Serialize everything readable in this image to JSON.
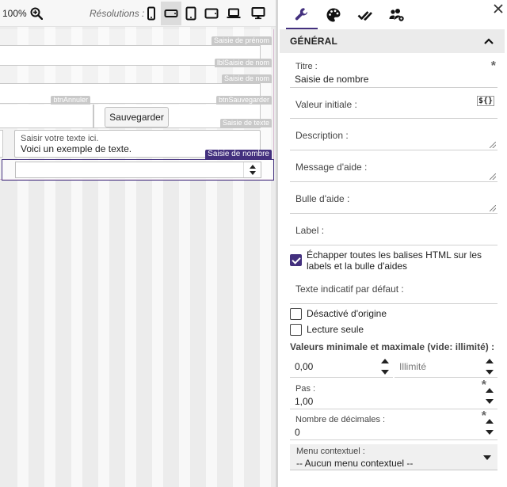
{
  "toolbar": {
    "zoom_level": "100%",
    "resolutions_label": "Résolutions :",
    "resolutions": [
      {
        "icon": "smartphone-portrait-icon",
        "active": false
      },
      {
        "icon": "smartphone-landscape-icon",
        "active": true
      },
      {
        "icon": "tablet-portrait-icon",
        "active": false
      },
      {
        "icon": "tablet-landscape-icon",
        "active": false
      },
      {
        "icon": "laptop-icon",
        "active": false
      },
      {
        "icon": "desktop-icon",
        "active": false
      }
    ]
  },
  "canvas": {
    "tags": {
      "prenom": "Saisie de prénom",
      "lbl_nom": "lblSaisie de nom",
      "nom": "Saisie de nom",
      "btn_annuler": "btnAnnuler",
      "btn_sauvegarder": "btnSauvegarder",
      "texte": "Saisie de texte",
      "nombre": "Saisie de nombre"
    },
    "save_button_label": "Sauvegarder",
    "textarea_placeholder": "Saisir votre texte ici.",
    "textarea_value": "Voici un exemple de texte."
  },
  "properties": {
    "tabs": [
      {
        "icon": "wrench-icon",
        "active": true
      },
      {
        "icon": "palette-icon",
        "active": false
      },
      {
        "icon": "checkmarks-icon",
        "active": false
      },
      {
        "icon": "users-gear-icon",
        "active": false
      }
    ],
    "section_title": "GÉNÉRAL",
    "fields": {
      "titre_label": "Titre :",
      "titre_value": "Saisie de nombre",
      "valeur_initiale_label": "Valeur initiale :",
      "expression_icon_text": "${}",
      "description_label": "Description :",
      "message_aide_label": "Message d'aide :",
      "bulle_aide_label": "Bulle d'aide :",
      "label_label": "Label :",
      "echapper_label": "Échapper toutes les balises HTML sur les labels et la bulle d'aides",
      "echapper_checked": true,
      "texte_indicatif_label": "Texte indicatif par défaut :",
      "desactive_label": "Désactivé d'origine",
      "desactive_checked": false,
      "lecture_seule_label": "Lecture seule",
      "lecture_seule_checked": false,
      "minmax_label": "Valeurs minimale et maximale (vide: illimité) :",
      "min_value": "0,00",
      "max_placeholder": "Illimité",
      "pas_label": "Pas :",
      "pas_value": "1,00",
      "decimales_label": "Nombre de décimales :",
      "decimales_value": "0",
      "menu_label": "Menu contextuel :",
      "menu_value": "-- Aucun menu contextuel --"
    }
  }
}
